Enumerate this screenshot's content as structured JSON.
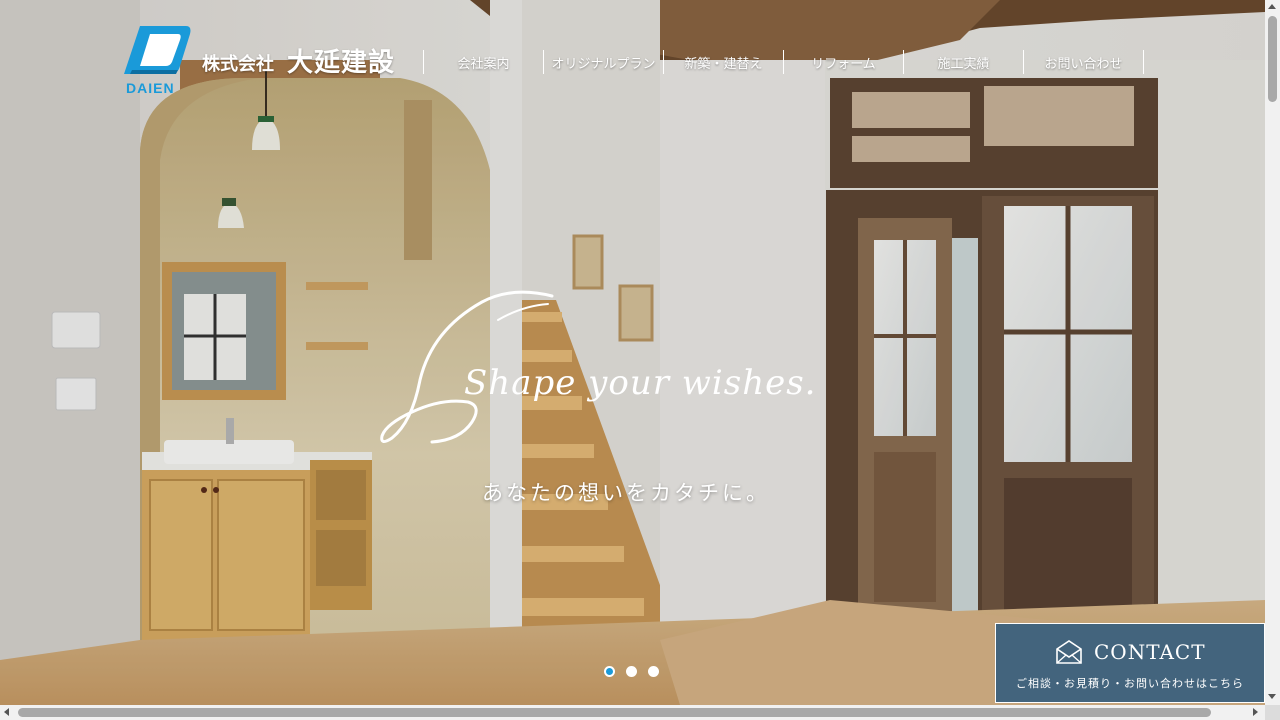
{
  "header": {
    "logo_en": "DAIEN",
    "logo_prefix": "株式会社",
    "logo_name": "大延建設",
    "nav": [
      {
        "label": "会社案内"
      },
      {
        "label": "オリジナルプラン"
      },
      {
        "label": "新築・建替え"
      },
      {
        "label": "リフォーム"
      },
      {
        "label": "施工実績"
      },
      {
        "label": "お問い合わせ"
      }
    ]
  },
  "hero": {
    "script_copy": "Shape your wishes.",
    "sub_copy": "あなたの想いをカタチに。",
    "slides": 3,
    "active_slide": 1
  },
  "contact": {
    "title": "CONTACT",
    "subtitle": "ご相談・お見積り・お問い合わせはこちら",
    "icon": "envelope-icon",
    "bg_color": "#43647d"
  },
  "colors": {
    "brand_blue": "#1a9ad9",
    "nav_text": "#ffffff"
  }
}
